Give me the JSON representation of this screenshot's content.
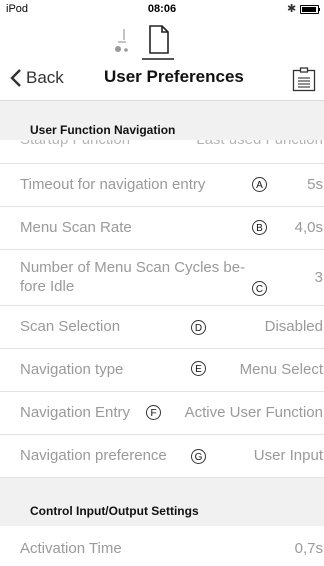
{
  "status": {
    "carrier": "iPod",
    "time": "08:06"
  },
  "navbar": {
    "back_label": "Back",
    "title": "User Preferences"
  },
  "sections": [
    {
      "header": "User Function Navigation"
    },
    {
      "header": "Control Input/Output Settings"
    }
  ],
  "partial_row": {
    "label": "Startup Function",
    "value": "Last used Function"
  },
  "rows": [
    {
      "label": "Timeout for navigation entry",
      "marker": "A",
      "value": "5s"
    },
    {
      "label": "Menu Scan Rate",
      "marker": "B",
      "value": "4,0s"
    },
    {
      "label_line1": "Number of Menu Scan Cycles be-",
      "label_line2": "fore Idle",
      "marker": "C",
      "value": "3"
    },
    {
      "label": "Scan Selection",
      "marker": "D",
      "value": "Disabled"
    },
    {
      "label": "Navigation type",
      "marker": "E",
      "value": "Menu Select"
    },
    {
      "label": "Navigation Entry",
      "marker": "F",
      "value": "Active User Function"
    },
    {
      "label": "Navigation preference",
      "marker": "G",
      "value": "User Input"
    },
    {
      "label": "Activation Time",
      "value": "0,7s"
    }
  ],
  "icons": {
    "chair_tab": "wheelchair-icon",
    "doc_tab": "document-icon",
    "back": "chevron-left-icon",
    "export": "export-document-icon",
    "bluetooth": "bluetooth-icon",
    "battery": "battery-icon"
  },
  "colors": {
    "text_muted": "#9a9a9a",
    "section_bg": "#f1f1f1"
  }
}
